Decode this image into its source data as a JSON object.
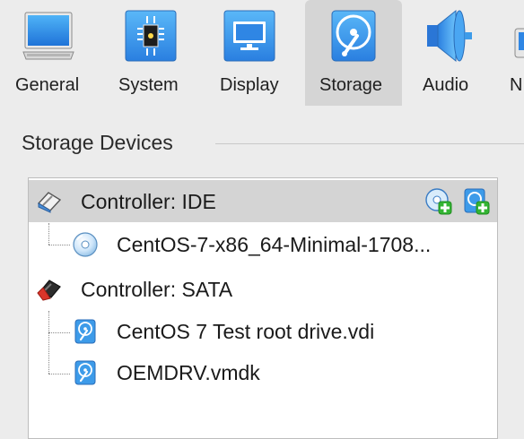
{
  "toolbar": {
    "items": [
      {
        "label": "General",
        "icon": "monitor-window-icon",
        "selected": false
      },
      {
        "label": "System",
        "icon": "chip-icon",
        "selected": false
      },
      {
        "label": "Display",
        "icon": "display-icon",
        "selected": false
      },
      {
        "label": "Storage",
        "icon": "disk-icon",
        "selected": true
      },
      {
        "label": "Audio",
        "icon": "speaker-icon",
        "selected": false
      },
      {
        "label": "N",
        "icon": "network-icon",
        "selected": false
      }
    ]
  },
  "storage": {
    "section_title": "Storage Devices",
    "controllers": [
      {
        "name": "Controller: IDE",
        "icon": "ide-controller-icon",
        "selected": true,
        "actions": [
          "add-optical-drive-icon",
          "add-hard-disk-icon"
        ],
        "attachments": [
          {
            "name": "CentOS-7-x86_64-Minimal-1708...",
            "icon": "optical-disc-icon"
          }
        ]
      },
      {
        "name": "Controller: SATA",
        "icon": "sata-controller-icon",
        "selected": false,
        "attachments": [
          {
            "name": "CentOS 7 Test root drive.vdi",
            "icon": "hard-disk-icon"
          },
          {
            "name": "OEMDRV.vmdk",
            "icon": "hard-disk-icon"
          }
        ]
      }
    ]
  },
  "colors": {
    "window_bg": "#ececec",
    "selected_bg": "#d4d4d4",
    "list_bg": "#ffffff",
    "icon_blue": "#3d9be9",
    "add_green": "#33b533"
  }
}
